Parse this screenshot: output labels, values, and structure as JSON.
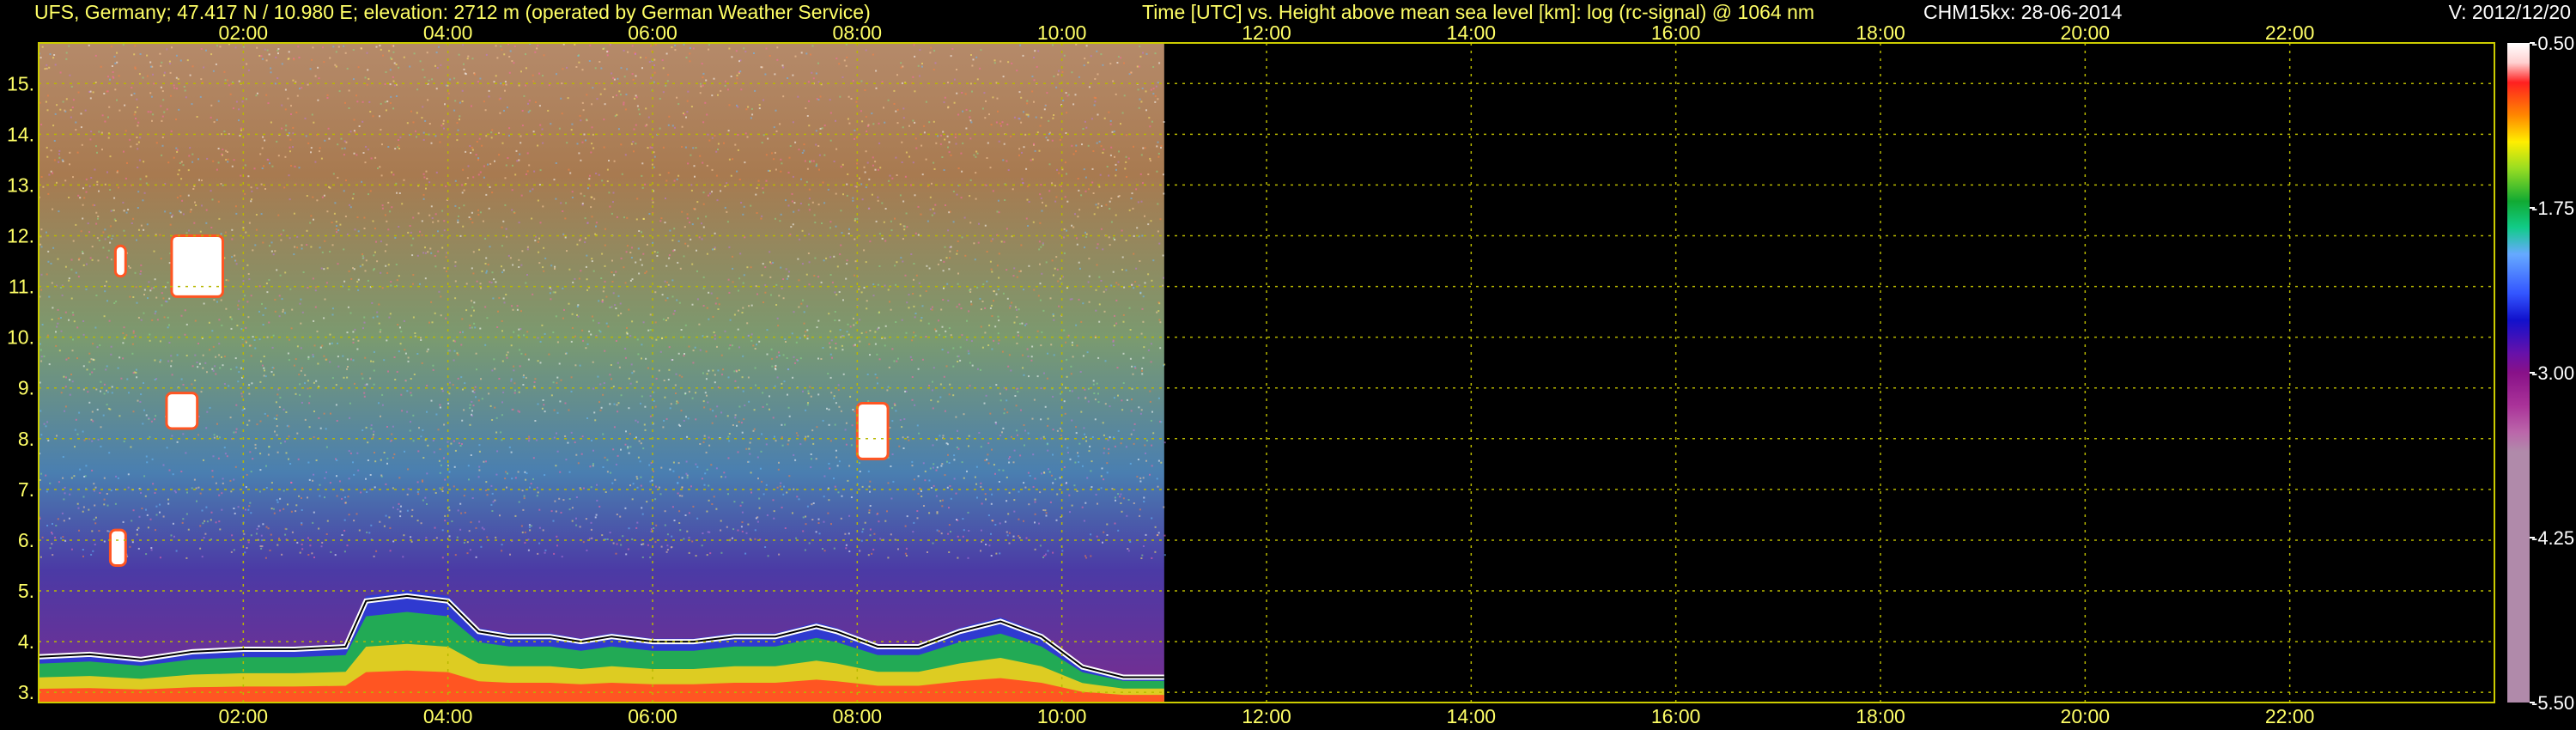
{
  "header": {
    "station": "UFS, Germany; 47.417 N / 10.980 E; elevation: 2712 m  (operated by German Weather Service)",
    "axis_title": "Time [UTC] vs. Height above mean sea level [km]: log (rc-signal) @ 1064 nm",
    "instrument_date": "CHM15kx: 28-06-2014",
    "version": "V: 2012/12/20"
  },
  "chart_data": {
    "type": "heatmap",
    "xlim": [
      0,
      24
    ],
    "ylim": [
      2.8,
      15.8
    ],
    "x_ticks": [
      2,
      4,
      6,
      8,
      10,
      12,
      14,
      16,
      18,
      20,
      22
    ],
    "x_tick_labels": [
      "02:00",
      "04:00",
      "06:00",
      "08:00",
      "10:00",
      "12:00",
      "14:00",
      "16:00",
      "18:00",
      "20:00",
      "22:00"
    ],
    "y_ticks": [
      3,
      4,
      5,
      6,
      7,
      8,
      9,
      10,
      11,
      12,
      13,
      14,
      15
    ],
    "y_tick_labels": [
      "3.",
      "4.",
      "5.",
      "6.",
      "7.",
      "8.",
      "9.",
      "10.",
      "11.",
      "12.",
      "13.",
      "14.",
      "15."
    ],
    "grid": true,
    "data_end_hour": 11.0,
    "colorbar": {
      "vmin": -5.5,
      "vmax": -0.5,
      "tick_values": [
        -0.5,
        -1.75,
        -3.0,
        -4.25,
        -5.5
      ],
      "tick_labels": [
        "-0.50",
        "-1.75",
        "-3.00",
        "-4.25",
        "-5.50"
      ]
    },
    "features": {
      "boundary_layer_top": [
        [
          0.0,
          3.7
        ],
        [
          0.5,
          3.75
        ],
        [
          1.0,
          3.65
        ],
        [
          1.5,
          3.8
        ],
        [
          2.0,
          3.85
        ],
        [
          2.5,
          3.85
        ],
        [
          3.0,
          3.9
        ],
        [
          3.2,
          4.8
        ],
        [
          3.6,
          4.9
        ],
        [
          4.0,
          4.8
        ],
        [
          4.3,
          4.2
        ],
        [
          4.6,
          4.1
        ],
        [
          5.0,
          4.1
        ],
        [
          5.3,
          4.0
        ],
        [
          5.6,
          4.1
        ],
        [
          6.0,
          4.0
        ],
        [
          6.4,
          4.0
        ],
        [
          6.8,
          4.1
        ],
        [
          7.2,
          4.1
        ],
        [
          7.6,
          4.3
        ],
        [
          7.8,
          4.2
        ],
        [
          8.2,
          3.9
        ],
        [
          8.6,
          3.9
        ],
        [
          9.0,
          4.2
        ],
        [
          9.4,
          4.4
        ],
        [
          9.8,
          4.1
        ],
        [
          10.2,
          3.5
        ],
        [
          10.6,
          3.3
        ],
        [
          11.0,
          3.3
        ]
      ],
      "clouds": [
        {
          "x": [
            1.3,
            1.8
          ],
          "y": [
            10.8,
            12.0
          ]
        },
        {
          "x": [
            1.25,
            1.55
          ],
          "y": [
            8.2,
            8.9
          ]
        },
        {
          "x": [
            0.75,
            0.85
          ],
          "y": [
            11.2,
            11.8
          ]
        },
        {
          "x": [
            0.7,
            0.85
          ],
          "y": [
            5.5,
            6.2
          ]
        },
        {
          "x": [
            8.0,
            8.3
          ],
          "y": [
            7.6,
            8.7
          ]
        }
      ]
    }
  }
}
